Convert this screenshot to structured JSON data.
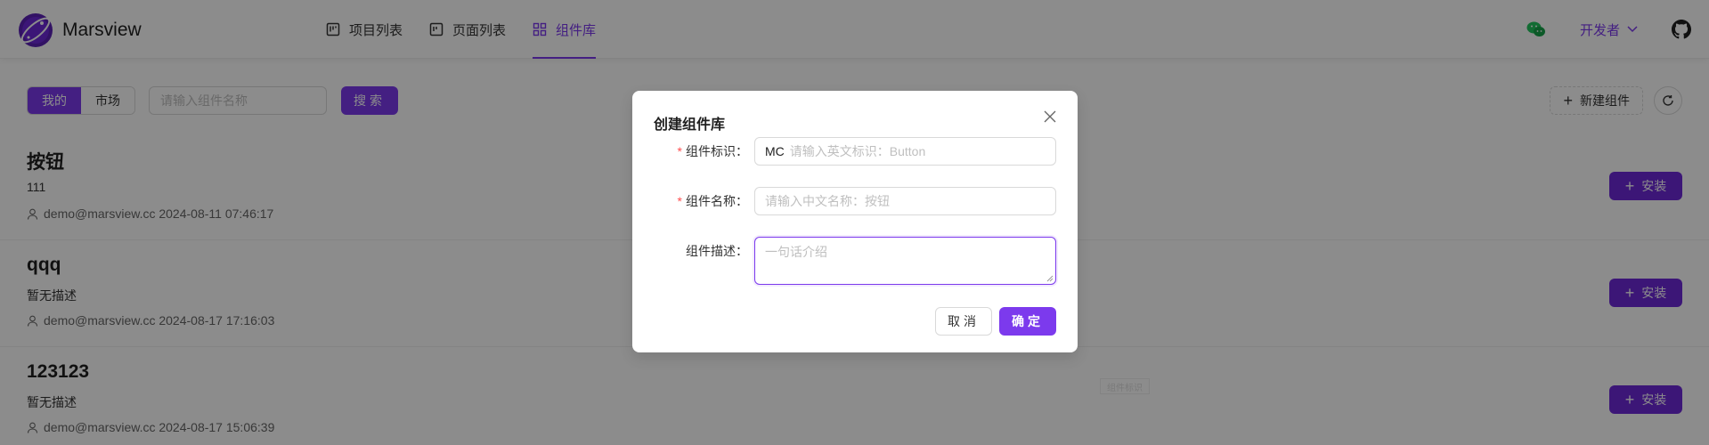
{
  "app": {
    "name": "Marsview"
  },
  "nav": {
    "items": [
      {
        "label": "项目列表",
        "icon": "project-icon"
      },
      {
        "label": "页面列表",
        "icon": "page-icon"
      },
      {
        "label": "组件库",
        "icon": "grid-icon",
        "active": true
      }
    ]
  },
  "header_right": {
    "user_role": "开发者"
  },
  "toolbar": {
    "tabs": [
      "我的",
      "市场"
    ],
    "search_placeholder": "请输入组件名称",
    "search_label": "搜索",
    "new_label": "新建组件"
  },
  "libraries": [
    {
      "title": "按钮",
      "description": "111",
      "author": "demo@marsview.cc",
      "time": "2024-08-11 07:46:17",
      "install_label": "安装"
    },
    {
      "title": "qqq",
      "description": "暂无描述",
      "author": "demo@marsview.cc",
      "time": "2024-08-17 17:16:03",
      "install_label": "安装"
    },
    {
      "title": "123123",
      "description": "暂无描述",
      "author": "demo@marsview.cc",
      "time": "2024-08-17 15:06:39",
      "install_label": "安装"
    }
  ],
  "ghost_label": "组件标识",
  "modal": {
    "title": "创建组件库",
    "fields": {
      "tag": {
        "label": "组件标识",
        "required": true,
        "prefix": "MC",
        "placeholder": "请输入英文标识：Button"
      },
      "name": {
        "label": "组件名称",
        "required": true,
        "placeholder": "请输入中文名称：按钮"
      },
      "desc": {
        "label": "组件描述",
        "required": false,
        "placeholder": "一句话介绍"
      }
    },
    "cancel_label": "取消",
    "ok_label": "确定"
  },
  "colors": {
    "accent": "#7c3aed",
    "required": "#ff4d4f",
    "overlay": "rgba(0,0,0,0.45)"
  }
}
